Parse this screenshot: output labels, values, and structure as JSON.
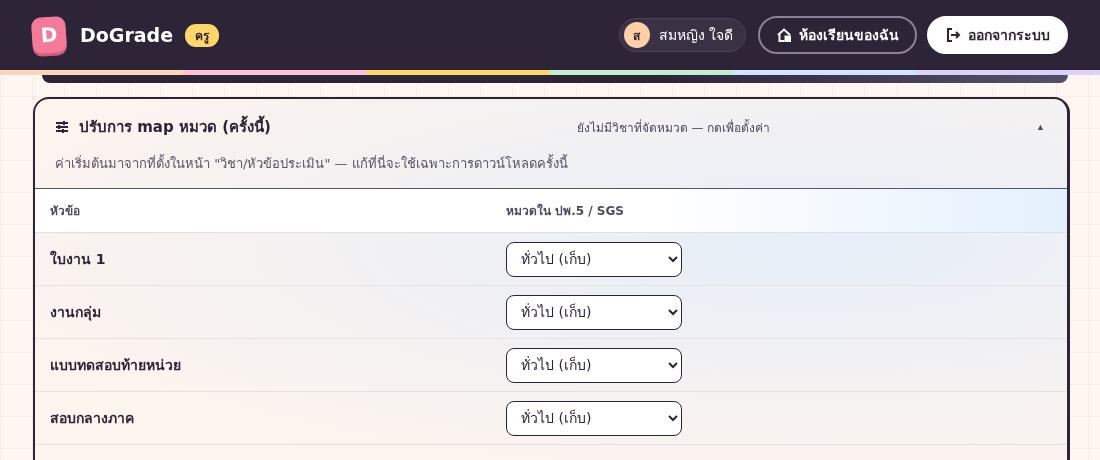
{
  "header": {
    "logo_letter": "D",
    "app_name": "DoGrade",
    "role_badge": "ครู",
    "user": {
      "initial": "ส",
      "name": "สมหญิง ใจดี"
    },
    "buttons": [
      {
        "kind": "outline",
        "label": "ห้องเรียนของฉัน"
      },
      {
        "kind": "solid",
        "label": "ออกจากระบบ"
      }
    ]
  },
  "mapping_panel": {
    "title": "ปรับการ map หมวด (ครั้งนี้)",
    "status": "ยังไม่มีวิชาที่จัดหมวด — กดเพื่อตั้งค่า",
    "toggle": "▲",
    "expanded": true,
    "description": "ค่าเริ่มต้นมาจากที่ตั้งในหน้า \"วิชา/หัวข้อประเมิน\" — แก้ที่นี่จะใช้เฉพาะการดาวน์โหลดครั้งนี้",
    "columns": [
      "หัวข้อ",
      "หมวดใน ปพ.5 / SGS"
    ],
    "rows": [
      {
        "topic": "ใบงาน 1",
        "category": "ทั่วไป (เก็บ)"
      },
      {
        "topic": "งานกลุ่ม",
        "category": "ทั่วไป (เก็บ)"
      },
      {
        "topic": "แบบทดสอบท้ายหน่วย",
        "category": "ทั่วไป (เก็บ)"
      },
      {
        "topic": "สอบกลางภาค",
        "category": "ทั่วไป (เก็บ)"
      }
    ]
  }
}
